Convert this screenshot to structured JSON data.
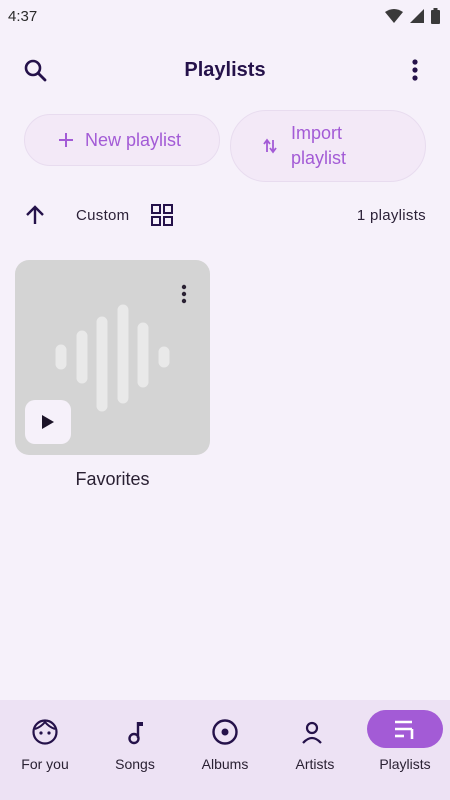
{
  "status": {
    "time": "4:37"
  },
  "header": {
    "title": "Playlists"
  },
  "actions": {
    "new_label": "New playlist",
    "import_label": "Import playlist"
  },
  "sort": {
    "label": "Custom",
    "count": "1 playlists"
  },
  "playlists": [
    {
      "title": "Favorites"
    }
  ],
  "nav": {
    "items": [
      {
        "label": "For you",
        "icon": "face-icon"
      },
      {
        "label": "Songs",
        "icon": "music-note-icon"
      },
      {
        "label": "Albums",
        "icon": "album-icon"
      },
      {
        "label": "Artists",
        "icon": "artist-icon"
      },
      {
        "label": "Playlists",
        "icon": "playlist-icon"
      }
    ],
    "active": "Playlists"
  },
  "colors": {
    "accent": "#a35bd6",
    "title": "#25124a",
    "background": "#f6f1fa",
    "nav_bg": "#ede2f4"
  }
}
